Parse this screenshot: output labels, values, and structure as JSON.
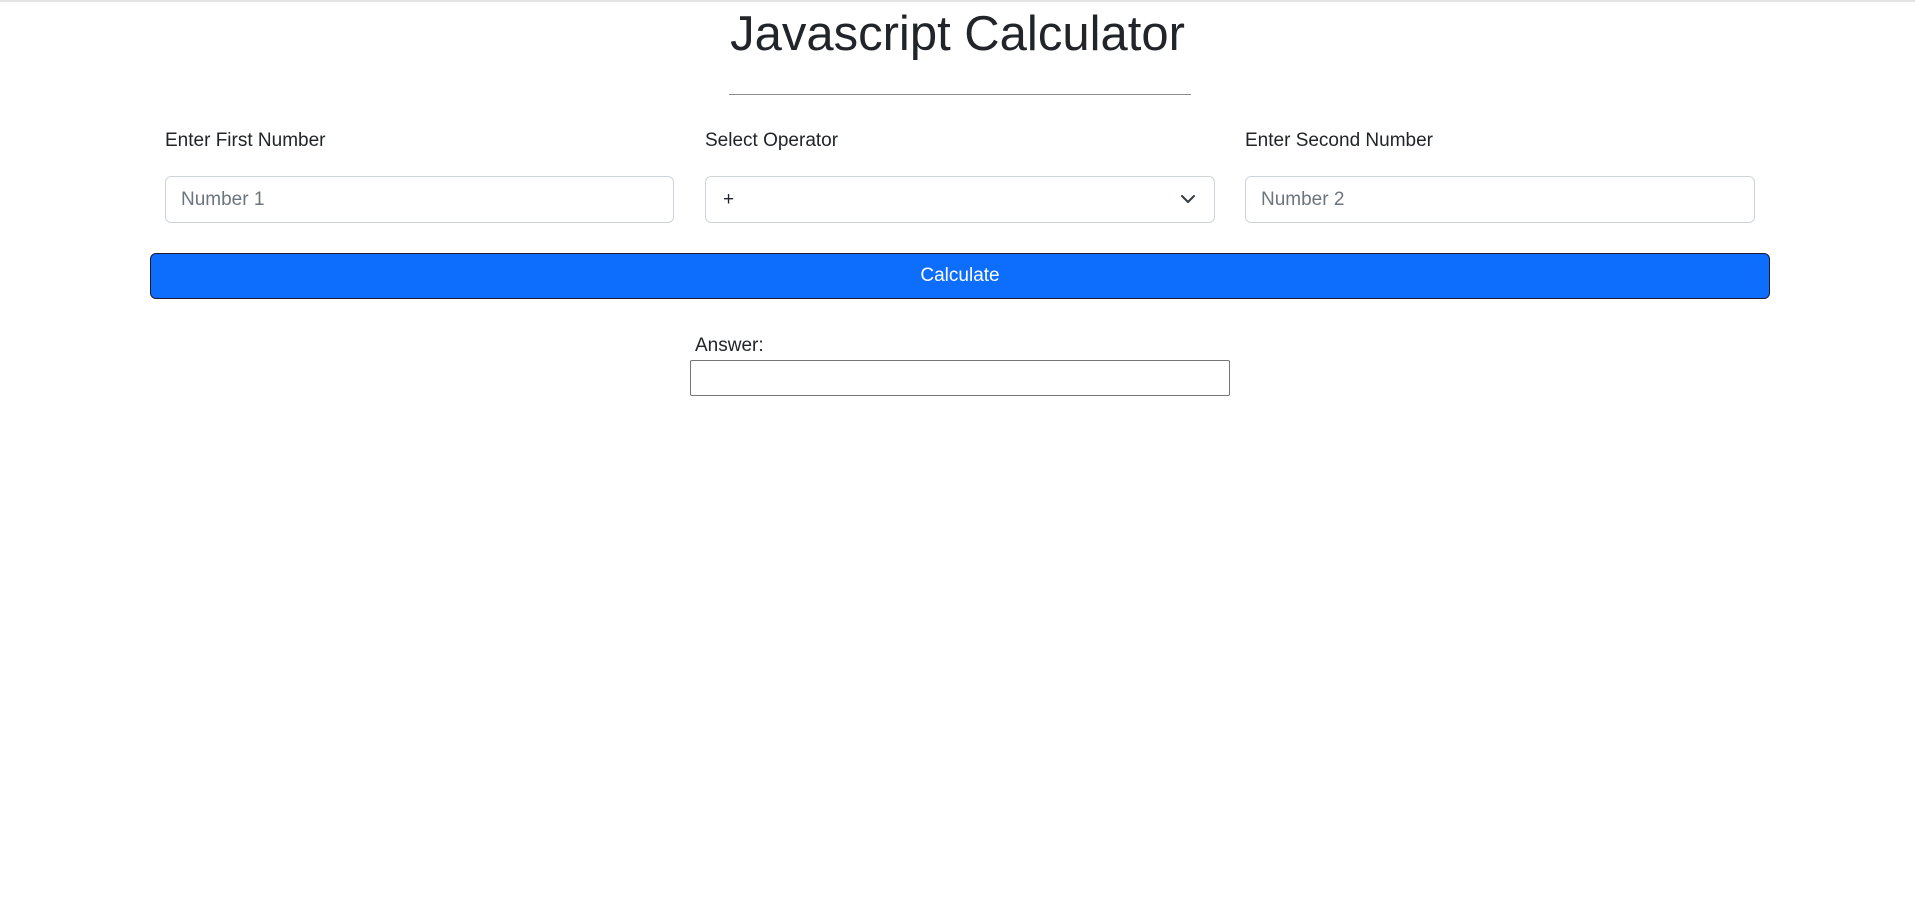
{
  "page": {
    "title": "Javascript Calculator"
  },
  "form": {
    "first_number": {
      "label": "Enter First Number",
      "placeholder": "Number 1",
      "value": ""
    },
    "operator": {
      "label": "Select Operator",
      "selected": "+"
    },
    "second_number": {
      "label": "Enter Second Number",
      "placeholder": "Number 2",
      "value": ""
    },
    "calculate_label": "Calculate"
  },
  "answer": {
    "label": "Answer:",
    "value": ""
  },
  "colors": {
    "button_bg": "#0d6efd",
    "text": "#212529",
    "placeholder": "#6c757d"
  },
  "icons": {
    "operator_dropdown": "chevron-down-icon"
  }
}
